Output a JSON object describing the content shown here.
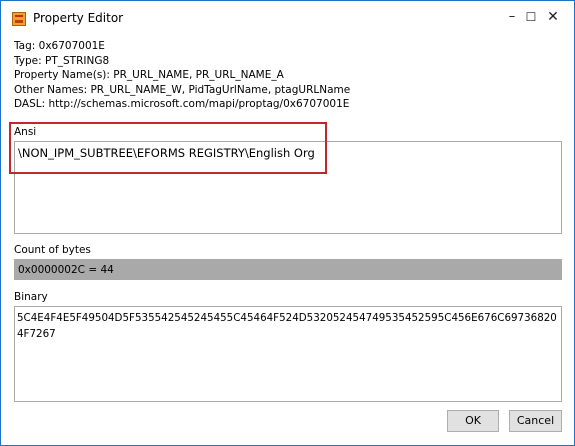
{
  "window": {
    "title": "Property Editor",
    "caption_min": "–",
    "caption_max": "☐",
    "caption_close": "✕"
  },
  "info": {
    "tag": "Tag: 0x6707001E",
    "type": "Type: PT_STRING8",
    "property_names": "Property Name(s): PR_URL_NAME, PR_URL_NAME_A",
    "other_names": "Other Names: PR_URL_NAME_W, PidTagUrlName, ptagURLName",
    "dasl": "DASL: http://schemas.microsoft.com/mapi/proptag/0x6707001E"
  },
  "ansi": {
    "label": "Ansi",
    "value": "\\NON_IPM_SUBTREE\\EFORMS REGISTRY\\English Org"
  },
  "count_of_bytes": {
    "label": "Count of bytes",
    "value": "0x0000002C = 44"
  },
  "binary": {
    "label": "Binary",
    "value": "5C4E4F4E5F49504D5F535542545245455C45464F524D532052454749535452595C456E676C697368204F7267"
  },
  "buttons": {
    "ok": "OK",
    "cancel": "Cancel"
  },
  "colors": {
    "window_border": "#1a73c8",
    "highlight": "#c0282e",
    "readonly_fill": "#a9a9a9"
  }
}
